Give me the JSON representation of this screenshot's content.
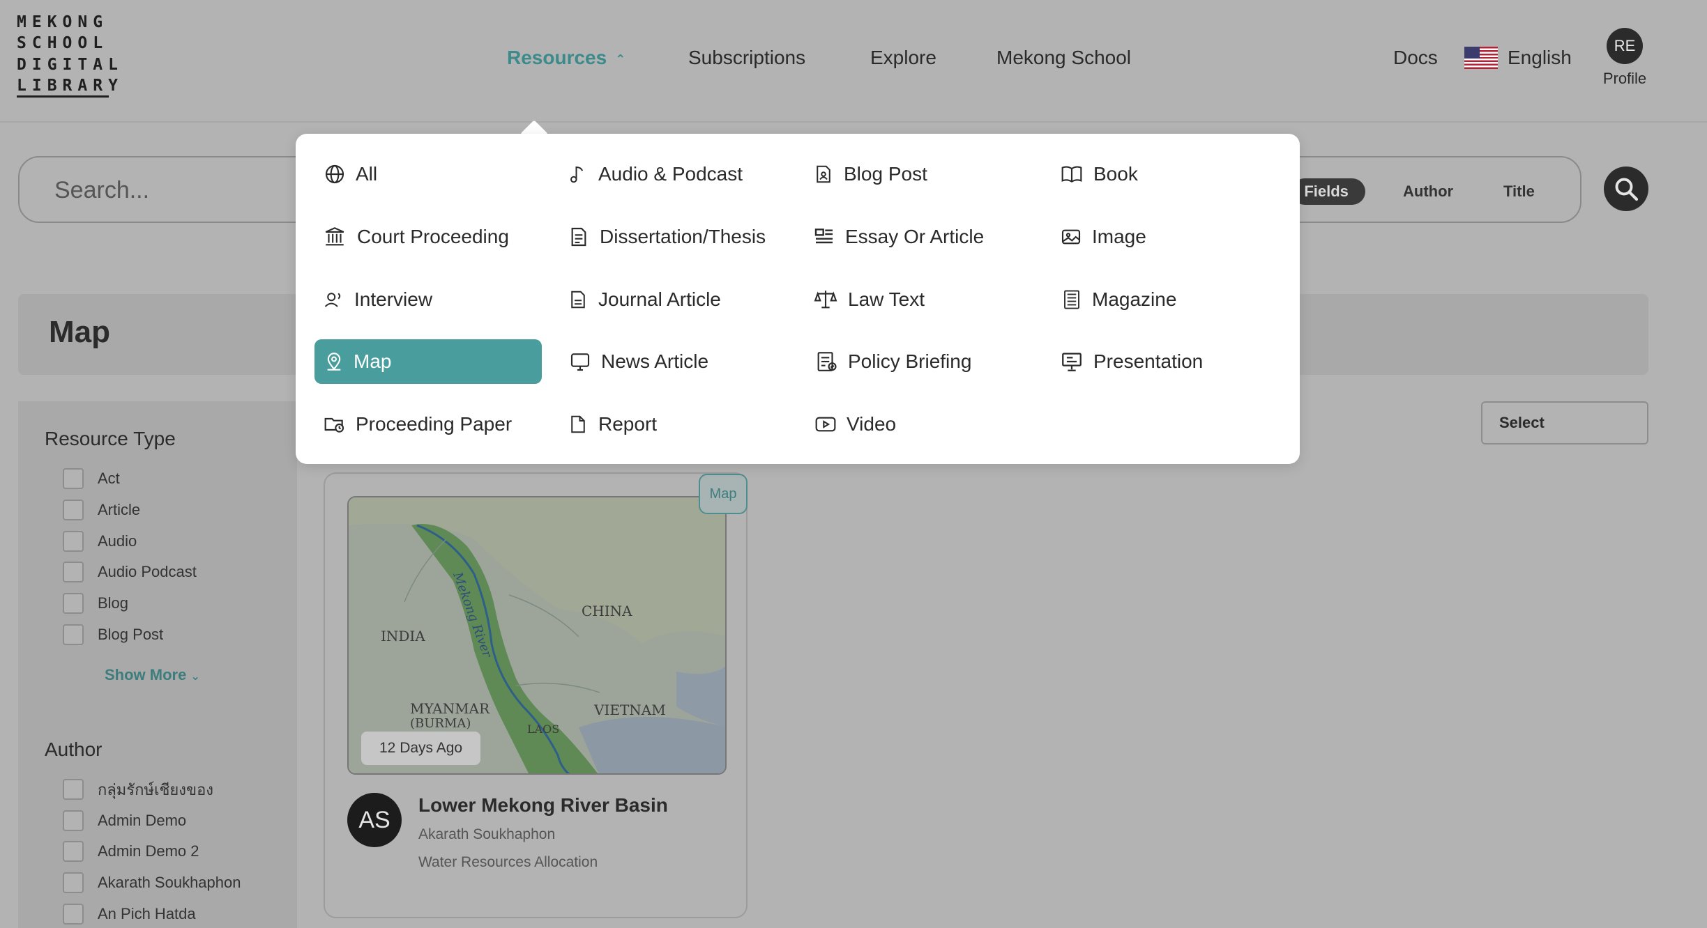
{
  "logo": {
    "lines": [
      "MEKONG",
      "SCHOOL",
      "DIGITAL",
      "LIBRARY"
    ]
  },
  "nav": {
    "resources": "Resources",
    "subscriptions": "Subscriptions",
    "explore": "Explore",
    "mekong_school": "Mekong School",
    "docs": "Docs",
    "language": "English",
    "profile_initials": "RE",
    "profile_label": "Profile"
  },
  "search": {
    "placeholder": "Search...",
    "fields": [
      "ll Fields",
      "Author",
      "Title"
    ]
  },
  "page": {
    "title": "Map",
    "sort_label": "Select"
  },
  "sidebar": {
    "resource_type_heading": "Resource Type",
    "resource_types": [
      "Act",
      "Article",
      "Audio",
      "Audio Podcast",
      "Blog",
      "Blog Post"
    ],
    "show_more": "Show More",
    "author_heading": "Author",
    "authors": [
      "กลุ่มรักษ์เชียงของ",
      "Admin Demo",
      "Admin Demo 2",
      "Akarath Soukhaphon",
      "An Pich Hatda"
    ]
  },
  "card": {
    "badge": "Map",
    "date": "12 Days Ago",
    "avatar": "AS",
    "title": "Lower Mekong River Basin",
    "author": "Akarath Soukhaphon",
    "subtitle": "Water Resources Allocation",
    "map_labels": {
      "river": "Mekong River",
      "china": "CHINA",
      "india": "INDIA",
      "myanmar": "MYANMAR",
      "burma": "(BURMA)",
      "vietnam": "VIETNAM",
      "laos": "LAOS"
    }
  },
  "dropdown": {
    "items": [
      {
        "label": "All",
        "icon": "globe-icon"
      },
      {
        "label": "Audio & Podcast",
        "icon": "music-note-icon"
      },
      {
        "label": "Blog Post",
        "icon": "document-person-icon"
      },
      {
        "label": "Book",
        "icon": "open-book-icon"
      },
      {
        "label": "Court Proceeding",
        "icon": "courthouse-icon"
      },
      {
        "label": "Dissertation/Thesis",
        "icon": "thesis-icon"
      },
      {
        "label": "Essay Or Article",
        "icon": "article-lines-icon"
      },
      {
        "label": "Image",
        "icon": "image-icon"
      },
      {
        "label": "Interview",
        "icon": "interview-icon"
      },
      {
        "label": "Journal Article",
        "icon": "journal-icon"
      },
      {
        "label": "Law Text",
        "icon": "scales-icon"
      },
      {
        "label": "Magazine",
        "icon": "magazine-icon"
      },
      {
        "label": "Map",
        "icon": "map-pin-icon",
        "selected": true
      },
      {
        "label": "News Article",
        "icon": "monitor-icon"
      },
      {
        "label": "Policy Briefing",
        "icon": "policy-icon"
      },
      {
        "label": "Presentation",
        "icon": "presentation-icon"
      },
      {
        "label": "Proceeding Paper",
        "icon": "folder-clock-icon"
      },
      {
        "label": "Report",
        "icon": "file-icon"
      },
      {
        "label": "Video",
        "icon": "video-icon"
      }
    ]
  },
  "colors": {
    "accent": "#4a9d9d",
    "overlay_bg": "#b3b3b3",
    "dark": "#2b2b2b"
  }
}
